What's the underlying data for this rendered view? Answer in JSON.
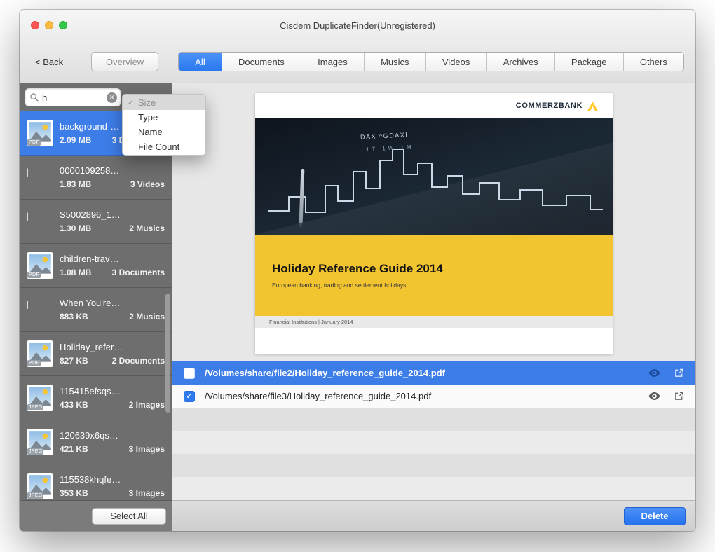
{
  "window": {
    "title": "Cisdem DuplicateFinder(Unregistered)"
  },
  "toolbar": {
    "back_label": "< Back",
    "overview_label": "Overview",
    "tabs": [
      {
        "label": "All",
        "active": true
      },
      {
        "label": "Documents"
      },
      {
        "label": "Images"
      },
      {
        "label": "Musics"
      },
      {
        "label": "Videos"
      },
      {
        "label": "Archives"
      },
      {
        "label": "Package"
      },
      {
        "label": "Others"
      }
    ]
  },
  "sidebar": {
    "search": {
      "value": "h"
    },
    "items": [
      {
        "name": "background-…",
        "size": "2.09 MB",
        "count": "3 Documents",
        "badge": "PDF",
        "kind": "pdf",
        "selected": true
      },
      {
        "name": "0000109258…",
        "size": "1.83 MB",
        "count": "3 Videos",
        "kind": "generic"
      },
      {
        "name": "S5002896_1…",
        "size": "1.30 MB",
        "count": "2 Musics",
        "kind": "generic"
      },
      {
        "name": "children-trav…",
        "size": "1.08 MB",
        "count": "3 Documents",
        "badge": "PDF",
        "kind": "pdf"
      },
      {
        "name": "When You're…",
        "size": "883 KB",
        "count": "2 Musics",
        "kind": "generic"
      },
      {
        "name": "Holiday_refer…",
        "size": "827 KB",
        "count": "2 Documents",
        "badge": "PDF",
        "kind": "pdf"
      },
      {
        "name": "115415efsqs…",
        "size": "433 KB",
        "count": "2 Images",
        "badge": "JPEG",
        "kind": "jpeg"
      },
      {
        "name": "120639x6qs…",
        "size": "421 KB",
        "count": "3 Images",
        "badge": "JPEG",
        "kind": "jpeg"
      },
      {
        "name": "115538khqfe…",
        "size": "353 KB",
        "count": "3 Images",
        "badge": "JPEG",
        "kind": "jpeg"
      }
    ],
    "select_all_label": "Select All"
  },
  "sort_menu": {
    "items": [
      {
        "label": "Size",
        "checked": true
      },
      {
        "label": "Type"
      },
      {
        "label": "Name"
      },
      {
        "label": "File Count"
      }
    ]
  },
  "preview": {
    "brand": "COMMERZBANK",
    "photo": {
      "index_label": "DAX ^GDAXI",
      "ranges": "1T 1W 1M"
    },
    "title": "Holiday Reference Guide 2014",
    "subtitle": "European banking, trading and settlement holidays",
    "footer_note": "Financial Institutions  |  January 2014"
  },
  "file_rows": [
    {
      "path": "/Volumes/share/file2/Holiday_reference_guide_2014.pdf",
      "checked": false,
      "selected": true
    },
    {
      "path": "/Volumes/share/file3/Holiday_reference_guide_2014.pdf",
      "checked": true,
      "selected": false
    }
  ],
  "footer": {
    "delete_label": "Delete"
  },
  "glyphs": {
    "check": "✓",
    "clear": "✕"
  },
  "colors": {
    "accent_blue": "#2F7CF0",
    "selection_blue": "#3D7DE8",
    "sidebar_gray": "#6E6E6E",
    "banner_yellow": "#F2C430",
    "logo_yellow": "#FFCC33"
  }
}
